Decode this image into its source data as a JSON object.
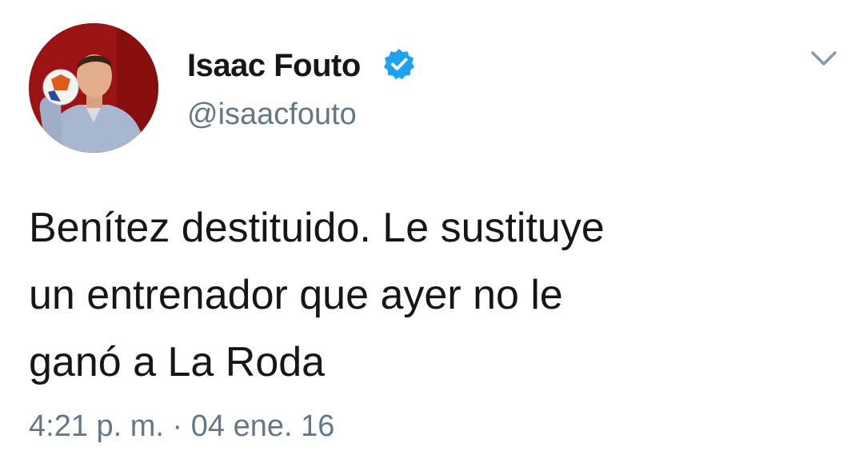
{
  "user": {
    "display_name": "Isaac Fouto",
    "handle": "@isaacfouto",
    "verified": true,
    "avatar_icon": "profile-photo-with-football"
  },
  "tweet": {
    "lines": [
      "Benítez destituido. Le sustituye",
      "un entrenador que ayer no le",
      "ganó a La Roda"
    ]
  },
  "meta": {
    "timestamp": "4:21 p. m. · 04 ene. 16"
  },
  "colors": {
    "text": "#14171a",
    "secondary": "#657786",
    "verified_blue": "#1da1f2",
    "avatar_bg": "#a01414"
  },
  "icons": {
    "verified": "verified-badge-icon",
    "menu": "chevron-down-icon"
  }
}
